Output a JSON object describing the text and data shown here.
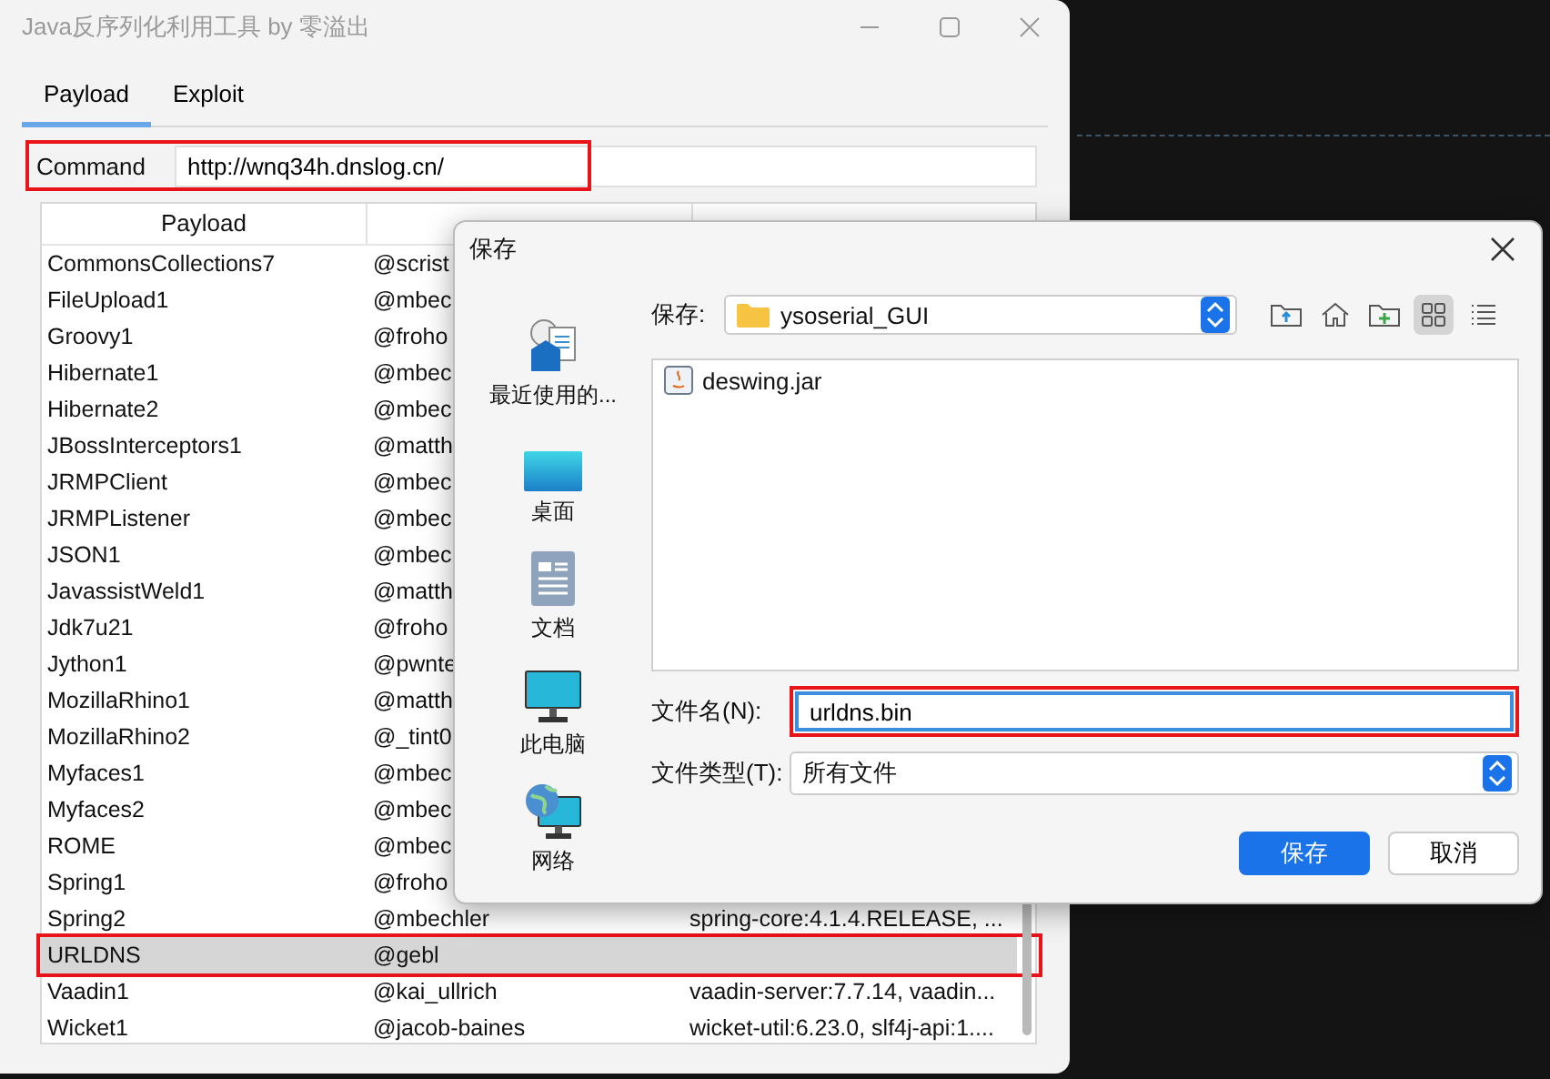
{
  "window": {
    "title": "Java反序列化利用工具 by 零溢出"
  },
  "tabs": [
    {
      "label": "Payload",
      "selected": true
    },
    {
      "label": "Exploit",
      "selected": false
    }
  ],
  "command": {
    "label": "Command",
    "value": "http://wnq34h.dnslog.cn/",
    "annotated": true
  },
  "table": {
    "columns": [
      "Payload"
    ],
    "rows": [
      {
        "column_1": "CommonsCollections7",
        "column_2": "@scrist",
        "selected": false,
        "annotated": false
      },
      {
        "column_1": "FileUpload1",
        "column_2": "@mbec",
        "selected": false,
        "annotated": false
      },
      {
        "column_1": "Groovy1",
        "column_2": "@froho",
        "selected": false,
        "annotated": false
      },
      {
        "column_1": "Hibernate1",
        "column_2": "@mbec",
        "selected": false,
        "annotated": false
      },
      {
        "column_1": "Hibernate2",
        "column_2": "@mbec",
        "selected": false,
        "annotated": false
      },
      {
        "column_1": "JBossInterceptors1",
        "column_2": "@matth",
        "selected": false,
        "annotated": false
      },
      {
        "column_1": "JRMPClient",
        "column_2": "@mbec",
        "selected": false,
        "annotated": false
      },
      {
        "column_1": "JRMPListener",
        "column_2": "@mbec",
        "selected": false,
        "annotated": false
      },
      {
        "column_1": "JSON1",
        "column_2": "@mbec",
        "selected": false,
        "annotated": false
      },
      {
        "column_1": "JavassistWeld1",
        "column_2": "@matth",
        "selected": false,
        "annotated": false
      },
      {
        "column_1": "Jdk7u21",
        "column_2": "@froho",
        "selected": false,
        "annotated": false
      },
      {
        "column_1": "Jython1",
        "column_2": "@pwnte",
        "selected": false,
        "annotated": false
      },
      {
        "column_1": "MozillaRhino1",
        "column_2": "@matth",
        "selected": false,
        "annotated": false
      },
      {
        "column_1": "MozillaRhino2",
        "column_2": "@_tint0",
        "selected": false,
        "annotated": false
      },
      {
        "column_1": "Myfaces1",
        "column_2": "@mbec",
        "selected": false,
        "annotated": false
      },
      {
        "column_1": "Myfaces2",
        "column_2": "@mbec",
        "selected": false,
        "annotated": false
      },
      {
        "column_1": "ROME",
        "column_2": "@mbec",
        "selected": false,
        "annotated": false
      },
      {
        "column_1": "Spring1",
        "column_2": "@froho",
        "selected": false,
        "annotated": false
      },
      {
        "column_1": "Spring2",
        "column_2": "@mbechler",
        "column_3": "spring-core:4.1.4.RELEASE, ...",
        "selected": false,
        "annotated": false
      },
      {
        "column_1": "URLDNS",
        "column_2": "@gebl",
        "selected": true,
        "annotated": true
      },
      {
        "column_1": "Vaadin1",
        "column_2": "@kai_ullrich",
        "column_3": "vaadin-server:7.7.14, vaadin...",
        "selected": false,
        "annotated": false
      },
      {
        "column_1": "Wicket1",
        "column_2": "@jacob-baines",
        "column_3": "wicket-util:6.23.0, slf4j-api:1....",
        "selected": false,
        "annotated": false
      }
    ]
  },
  "dialog": {
    "title": "保存",
    "places": [
      {
        "label": "最近使用的...",
        "kind": "recent"
      },
      {
        "label": "桌面",
        "kind": "desktop"
      },
      {
        "label": "文档",
        "kind": "documents"
      },
      {
        "label": "此电脑",
        "kind": "computer"
      },
      {
        "label": "网络",
        "kind": "network"
      }
    ],
    "save_in": {
      "label": "保存:",
      "value": "ysoserial_GUI"
    },
    "toolbar": [
      {
        "kind": "up",
        "selected": false
      },
      {
        "kind": "home",
        "selected": false
      },
      {
        "kind": "new-folder",
        "selected": false
      },
      {
        "kind": "grid",
        "selected": true
      },
      {
        "kind": "list",
        "selected": false
      }
    ],
    "files": [
      {
        "name": "deswing.jar"
      }
    ],
    "file_name": {
      "label": "文件名(N):",
      "value": "urldns.bin",
      "annotated": true
    },
    "file_type": {
      "label": "文件类型(T):",
      "value": "所有文件"
    },
    "buttons": [
      {
        "label": "保存",
        "primary": true
      },
      {
        "label": "取消",
        "primary": false
      }
    ]
  }
}
